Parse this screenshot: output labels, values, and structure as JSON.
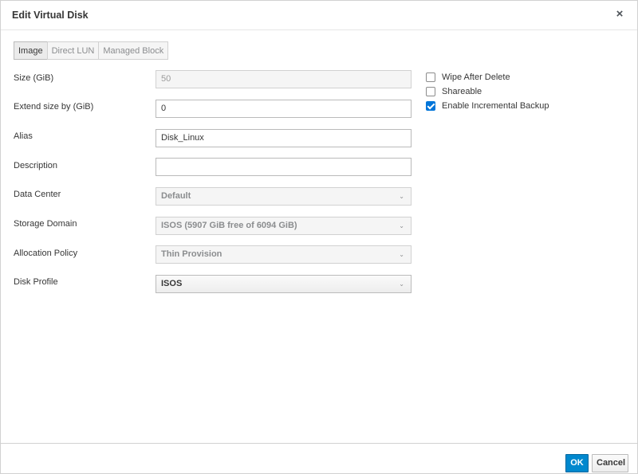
{
  "dialog": {
    "title": "Edit Virtual Disk",
    "close_glyph": "×"
  },
  "tabs": [
    {
      "label": "Image",
      "active": true
    },
    {
      "label": "Direct LUN",
      "active": false
    },
    {
      "label": "Managed Block",
      "active": false
    }
  ],
  "form": {
    "size": {
      "label": "Size (GiB)",
      "value": "50"
    },
    "extend": {
      "label": "Extend size by (GiB)",
      "value": "0"
    },
    "alias": {
      "label": "Alias",
      "value": "Disk_Linux"
    },
    "description": {
      "label": "Description",
      "value": ""
    },
    "data_center": {
      "label": "Data Center",
      "value": "Default"
    },
    "storage_domain": {
      "label": "Storage Domain",
      "value": "ISOS (5907 GiB free of 6094 GiB)"
    },
    "allocation_policy": {
      "label": "Allocation Policy",
      "value": "Thin Provision"
    },
    "disk_profile": {
      "label": "Disk Profile",
      "value": "ISOS"
    }
  },
  "options": {
    "wipe_after_delete": {
      "label": "Wipe After Delete",
      "checked": false
    },
    "shareable": {
      "label": "Shareable",
      "checked": false
    },
    "incremental_backup": {
      "label": "Enable Incremental Backup",
      "checked": true
    }
  },
  "footer": {
    "ok_label": "OK",
    "cancel_label": "Cancel"
  },
  "icons": {
    "chevron": "⌄"
  },
  "colors": {
    "primary": "#0088ce",
    "checkbox_checked": "#0075d9"
  }
}
